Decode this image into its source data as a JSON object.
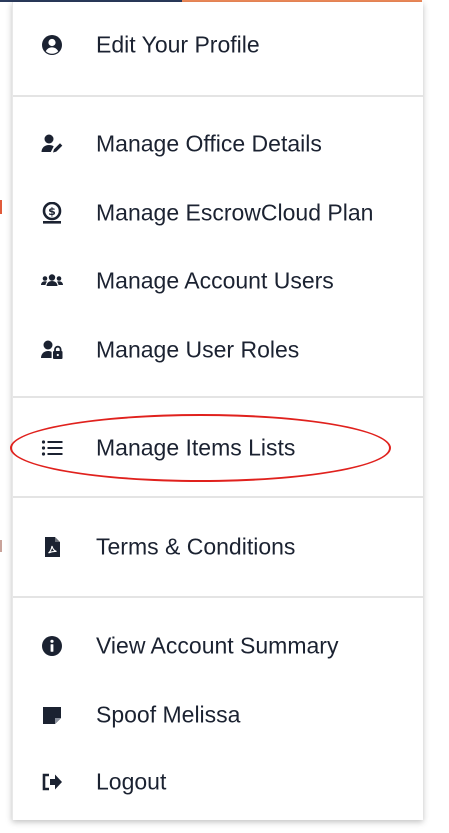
{
  "colors": {
    "text": "#1b2231",
    "icon": "#1b2231",
    "divider": "#e4e4e4",
    "highlight": "#e0211d",
    "accent_navy": "#2a3a5c",
    "accent_orange": "#f08a5a"
  },
  "menu": {
    "items": [
      {
        "label": "Edit Your Profile",
        "icon": "user-circle-icon"
      },
      {
        "label": "Manage Office Details",
        "icon": "user-edit-icon"
      },
      {
        "label": "Manage EscrowCloud Plan",
        "icon": "plan-coin-icon"
      },
      {
        "label": "Manage Account Users",
        "icon": "users-icon"
      },
      {
        "label": "Manage User Roles",
        "icon": "user-lock-icon"
      },
      {
        "label": "Manage Items Lists",
        "icon": "list-icon"
      },
      {
        "label": "Terms & Conditions",
        "icon": "pdf-file-icon"
      },
      {
        "label": "View Account Summary",
        "icon": "info-circle-icon"
      },
      {
        "label": "Spoof Melissa",
        "icon": "sticky-note-icon"
      },
      {
        "label": "Logout",
        "icon": "sign-out-icon"
      }
    ],
    "highlighted_item": "Manage Items Lists"
  }
}
